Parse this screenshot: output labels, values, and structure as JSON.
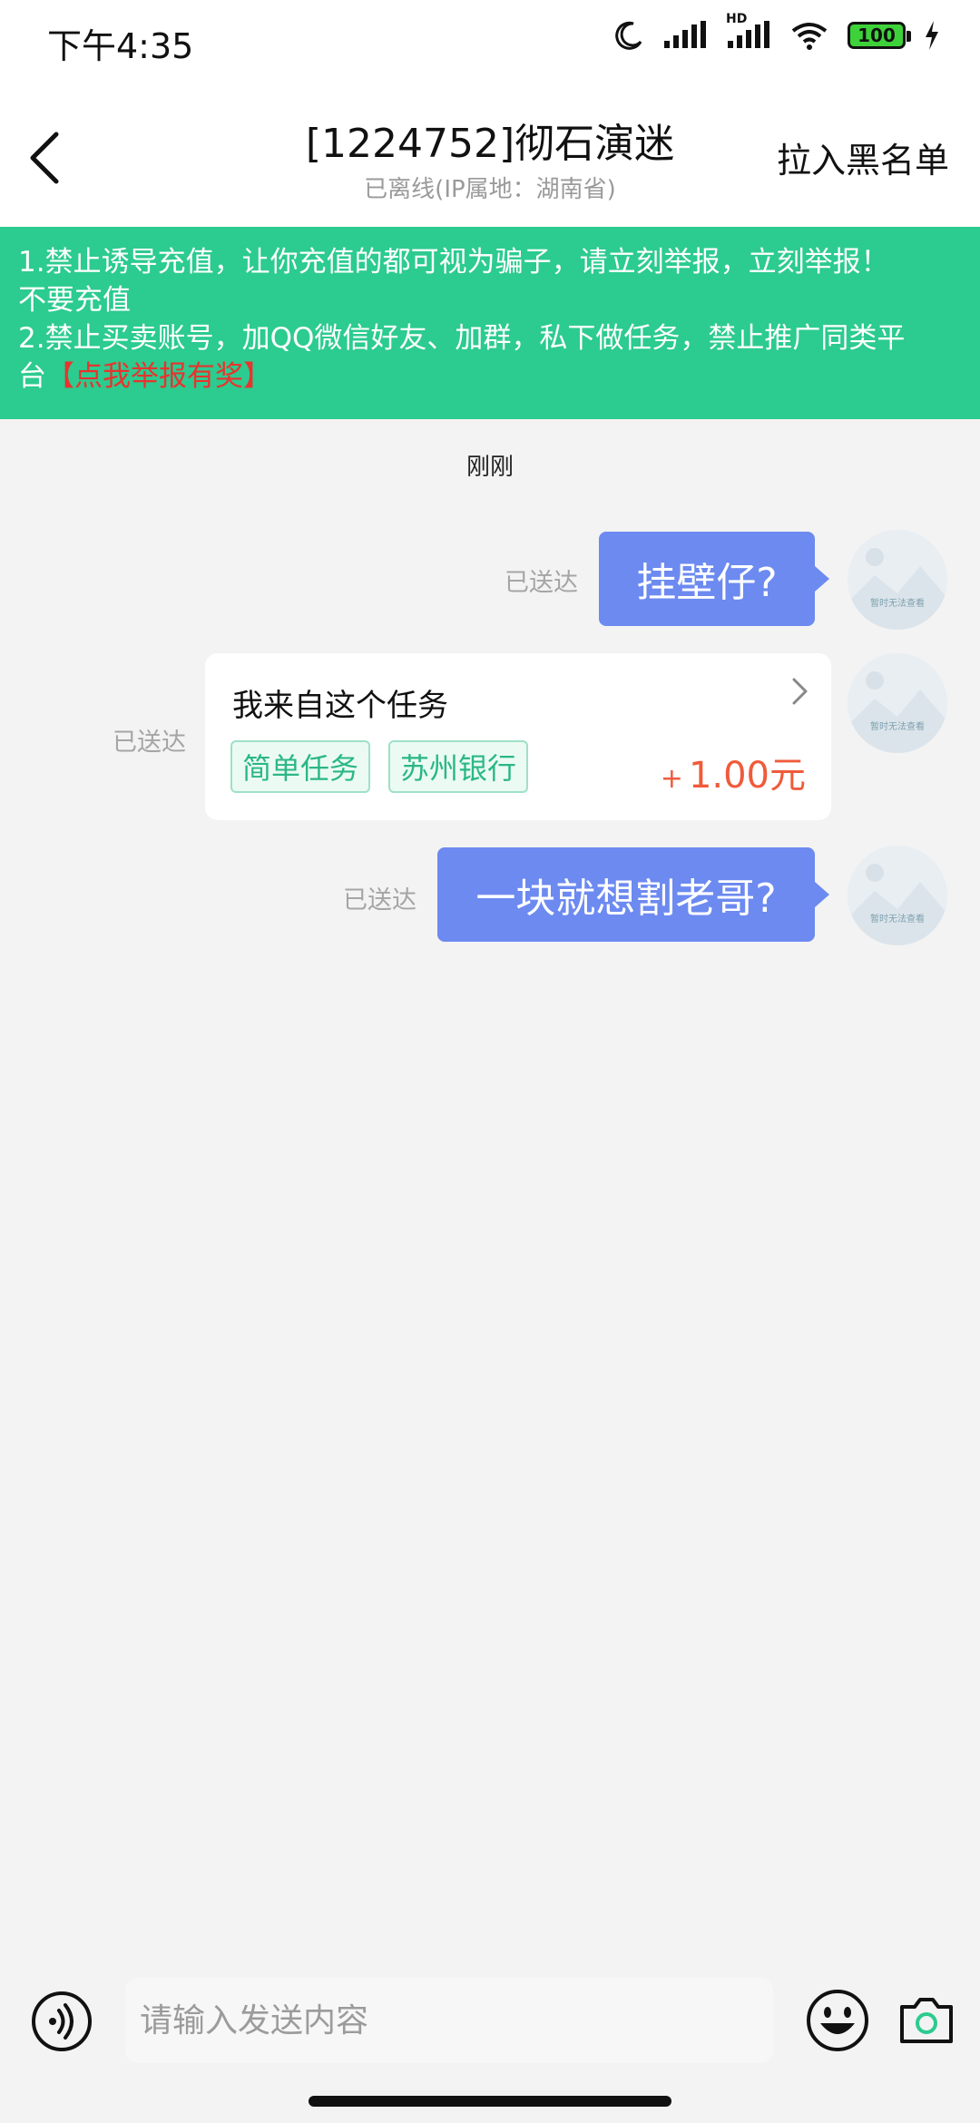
{
  "status": {
    "time": "下午4:35",
    "battery": "100",
    "signal_label": "HD"
  },
  "header": {
    "title": "[1224752]彻石演迷",
    "subtitle": "已离线(IP属地：湖南省)",
    "blacklist": "拉入黑名单"
  },
  "notice": {
    "line1": "1.禁止诱导充值，让你充值的都可视为骗子，请立刻举报，立刻举报！",
    "line2": "不要充值",
    "line3": "2.禁止买卖账号，加QQ微信好友、加群，私下做任务，禁止推广同类平",
    "line4_prefix": "台",
    "report_link": "【点我举报有奖】"
  },
  "chat": {
    "timestamp": "刚刚",
    "avatar_caption": "暂时无法查看",
    "messages": [
      {
        "type": "text",
        "status": "已送达",
        "text": "挂壁仔?"
      },
      {
        "type": "task",
        "status": "已送达",
        "title": "我来自这个任务",
        "tags": [
          "简单任务",
          "苏州银行"
        ],
        "reward_sign": "+",
        "reward": "1.00元"
      },
      {
        "type": "text",
        "status": "已送达",
        "text": "一块就想割老哥?"
      }
    ]
  },
  "input": {
    "placeholder": "请输入发送内容"
  },
  "colors": {
    "notice_bg": "#2ccb8f",
    "bubble": "#6c8af0",
    "accent_red": "#e8332e",
    "tag_green": "#2bb784"
  }
}
